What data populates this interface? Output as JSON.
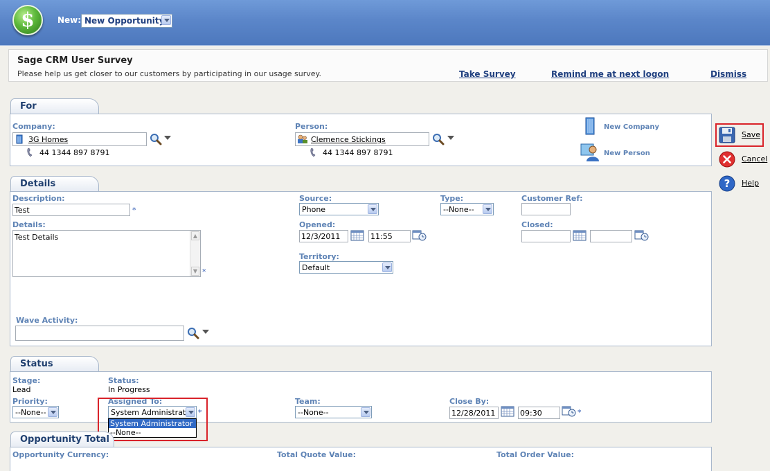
{
  "header": {
    "new_label": "New:",
    "new_select_value": "New Opportunity",
    "logo_glyph": "$"
  },
  "survey": {
    "title": "Sage CRM User Survey",
    "text": "Please help us get closer to our customers by participating in our usage survey.",
    "take_survey": "Take Survey",
    "remind": "Remind me at next logon",
    "dismiss": "Dismiss"
  },
  "for_panel": {
    "tab": "For",
    "company_label": "Company:",
    "company_value": "3G Homes",
    "company_phone": "44 1344 897 8791",
    "person_label": "Person:",
    "person_value": "Clemence Stickings",
    "person_phone": "44 1344 897 8791",
    "new_company": "New Company",
    "new_person": "New Person"
  },
  "details_panel": {
    "tab": "Details",
    "description_label": "Description:",
    "description_value": "Test",
    "details_label": "Details:",
    "details_value": "Test Details",
    "source_label": "Source:",
    "source_value": "Phone",
    "type_label": "Type:",
    "type_value": "--None--",
    "customer_ref_label": "Customer Ref:",
    "customer_ref_value": "",
    "opened_label": "Opened:",
    "opened_date": "12/3/2011",
    "opened_time": "11:55",
    "closed_label": "Closed:",
    "closed_date": "",
    "closed_time": "",
    "territory_label": "Territory:",
    "territory_value": "Default",
    "wave_label": "Wave Activity:",
    "wave_value": "",
    "required_mark": "*"
  },
  "status_panel": {
    "tab": "Status",
    "stage_label": "Stage:",
    "stage_value": "Lead",
    "status_label": "Status:",
    "status_value": "In Progress",
    "priority_label": "Priority:",
    "priority_value": "--None--",
    "assigned_label": "Assigned To:",
    "assigned_value": "System Administrator",
    "assigned_options": [
      "System Administrator",
      "--None--"
    ],
    "team_label": "Team:",
    "team_value": "--None--",
    "close_by_label": "Close By:",
    "close_by_date": "12/28/2011",
    "close_by_time": "09:30"
  },
  "totals_panel": {
    "tab": "Opportunity Total",
    "currency_label": "Opportunity Currency:",
    "quote_label": "Total Quote Value:",
    "order_label": "Total Order Value:"
  },
  "actions": {
    "save": "Save",
    "cancel": "Cancel",
    "help": "Help"
  },
  "colors": {
    "header_blue": "#5b86c9",
    "field_label": "#5e83b5",
    "highlight_red": "#d9232a",
    "selection_blue": "#316ac5"
  }
}
